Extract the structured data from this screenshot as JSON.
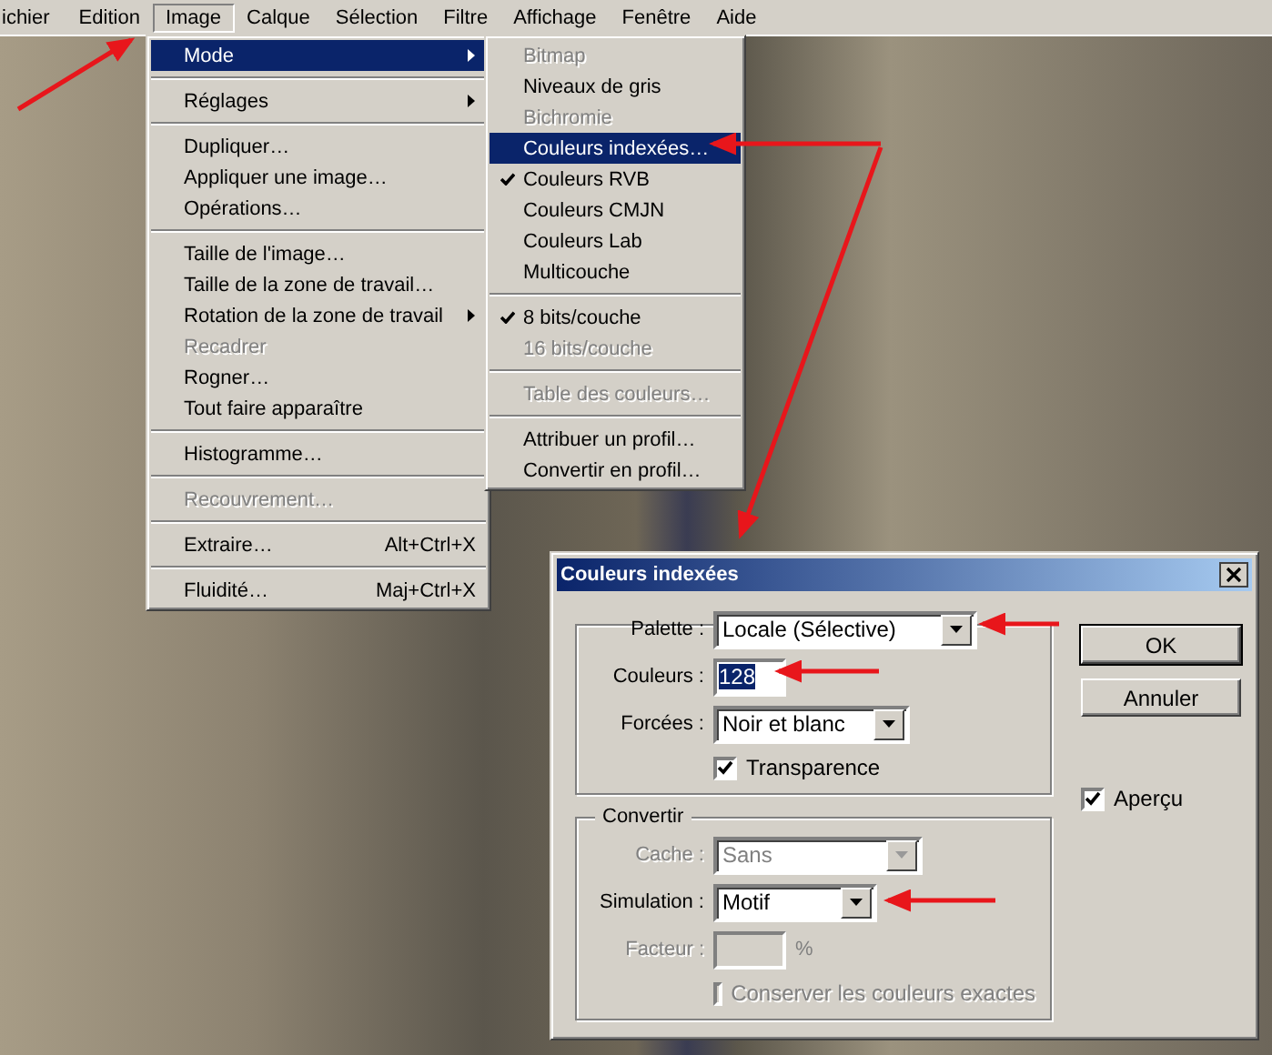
{
  "menubar": [
    {
      "label": "ichier",
      "selected": false
    },
    {
      "label": "Edition",
      "selected": false
    },
    {
      "label": "Image",
      "selected": true
    },
    {
      "label": "Calque",
      "selected": false
    },
    {
      "label": "Sélection",
      "selected": false
    },
    {
      "label": "Filtre",
      "selected": false
    },
    {
      "label": "Affichage",
      "selected": false
    },
    {
      "label": "Fenêtre",
      "selected": false
    },
    {
      "label": "Aide",
      "selected": false
    }
  ],
  "image_menu": [
    {
      "kind": "item",
      "label": "Mode",
      "selected": true,
      "disabled": false,
      "submenu": true
    },
    {
      "kind": "separator"
    },
    {
      "kind": "item",
      "label": "Réglages",
      "selected": false,
      "disabled": false,
      "submenu": true
    },
    {
      "kind": "separator"
    },
    {
      "kind": "item",
      "label": "Dupliquer…",
      "selected": false,
      "disabled": false,
      "submenu": false
    },
    {
      "kind": "item",
      "label": "Appliquer une image…",
      "selected": false,
      "disabled": false,
      "submenu": false
    },
    {
      "kind": "item",
      "label": "Opérations…",
      "selected": false,
      "disabled": false,
      "submenu": false
    },
    {
      "kind": "separator"
    },
    {
      "kind": "item",
      "label": "Taille de l'image…",
      "selected": false,
      "disabled": false,
      "submenu": false
    },
    {
      "kind": "item",
      "label": "Taille de la zone de travail…",
      "selected": false,
      "disabled": false,
      "submenu": false
    },
    {
      "kind": "item",
      "label": "Rotation de la zone de travail",
      "selected": false,
      "disabled": false,
      "submenu": true
    },
    {
      "kind": "item",
      "label": "Recadrer",
      "selected": false,
      "disabled": true,
      "submenu": false
    },
    {
      "kind": "item",
      "label": "Rogner…",
      "selected": false,
      "disabled": false,
      "submenu": false
    },
    {
      "kind": "item",
      "label": "Tout faire apparaître",
      "selected": false,
      "disabled": false,
      "submenu": false
    },
    {
      "kind": "separator"
    },
    {
      "kind": "item",
      "label": "Histogramme…",
      "selected": false,
      "disabled": false,
      "submenu": false
    },
    {
      "kind": "separator"
    },
    {
      "kind": "item",
      "label": "Recouvrement…",
      "selected": false,
      "disabled": true,
      "submenu": false
    },
    {
      "kind": "separator"
    },
    {
      "kind": "item",
      "label": "Extraire…",
      "shortcut": "Alt+Ctrl+X",
      "selected": false,
      "disabled": false,
      "submenu": false
    },
    {
      "kind": "separator"
    },
    {
      "kind": "item",
      "label": "Fluidité…",
      "shortcut": "Maj+Ctrl+X",
      "selected": false,
      "disabled": false,
      "submenu": false
    }
  ],
  "mode_submenu": [
    {
      "kind": "item",
      "label": "Bitmap",
      "selected": false,
      "disabled": true,
      "checked": false
    },
    {
      "kind": "item",
      "label": "Niveaux de gris",
      "selected": false,
      "disabled": false,
      "checked": false
    },
    {
      "kind": "item",
      "label": "Bichromie",
      "selected": false,
      "disabled": true,
      "checked": false
    },
    {
      "kind": "item",
      "label": "Couleurs indexées…",
      "selected": true,
      "disabled": false,
      "checked": false
    },
    {
      "kind": "item",
      "label": "Couleurs RVB",
      "selected": false,
      "disabled": false,
      "checked": true
    },
    {
      "kind": "item",
      "label": "Couleurs CMJN",
      "selected": false,
      "disabled": false,
      "checked": false
    },
    {
      "kind": "item",
      "label": "Couleurs Lab",
      "selected": false,
      "disabled": false,
      "checked": false
    },
    {
      "kind": "item",
      "label": "Multicouche",
      "selected": false,
      "disabled": false,
      "checked": false
    },
    {
      "kind": "separator"
    },
    {
      "kind": "item",
      "label": "8 bits/couche",
      "selected": false,
      "disabled": false,
      "checked": true
    },
    {
      "kind": "item",
      "label": "16 bits/couche",
      "selected": false,
      "disabled": true,
      "checked": false
    },
    {
      "kind": "separator"
    },
    {
      "kind": "item",
      "label": "Table des couleurs…",
      "selected": false,
      "disabled": true,
      "checked": false
    },
    {
      "kind": "separator"
    },
    {
      "kind": "item",
      "label": "Attribuer un profil…",
      "selected": false,
      "disabled": false,
      "checked": false
    },
    {
      "kind": "item",
      "label": "Convertir en profil…",
      "selected": false,
      "disabled": false,
      "checked": false
    }
  ],
  "dialog": {
    "title": "Couleurs indexées",
    "groups": [
      {
        "fields": [
          {
            "kind": "select",
            "label": "Palette :",
            "value": "Locale (Sélective)",
            "disabled": false
          },
          {
            "kind": "input",
            "label": "Couleurs :",
            "value": "128",
            "highlighted": true,
            "disabled": false
          },
          {
            "kind": "select",
            "label": "Forcées :",
            "value": "Noir et blanc",
            "disabled": false
          },
          {
            "kind": "checkbox",
            "label": "Transparence",
            "checked": true,
            "disabled": false
          }
        ]
      },
      {
        "legend": "Convertir",
        "fields": [
          {
            "kind": "select",
            "label": "Cache :",
            "value": "Sans",
            "disabled": true
          },
          {
            "kind": "select",
            "label": "Simulation :",
            "value": "Motif",
            "disabled": false
          },
          {
            "kind": "input",
            "label": "Facteur :",
            "unit": "%",
            "disabled": true
          },
          {
            "kind": "checkbox",
            "label": "Conserver les couleurs exactes",
            "checked": false,
            "disabled": true
          }
        ]
      }
    ],
    "buttons": [
      {
        "label": "OK",
        "default": true
      },
      {
        "label": "Annuler",
        "default": false
      }
    ],
    "preview": {
      "label": "Aperçu",
      "checked": true
    }
  }
}
